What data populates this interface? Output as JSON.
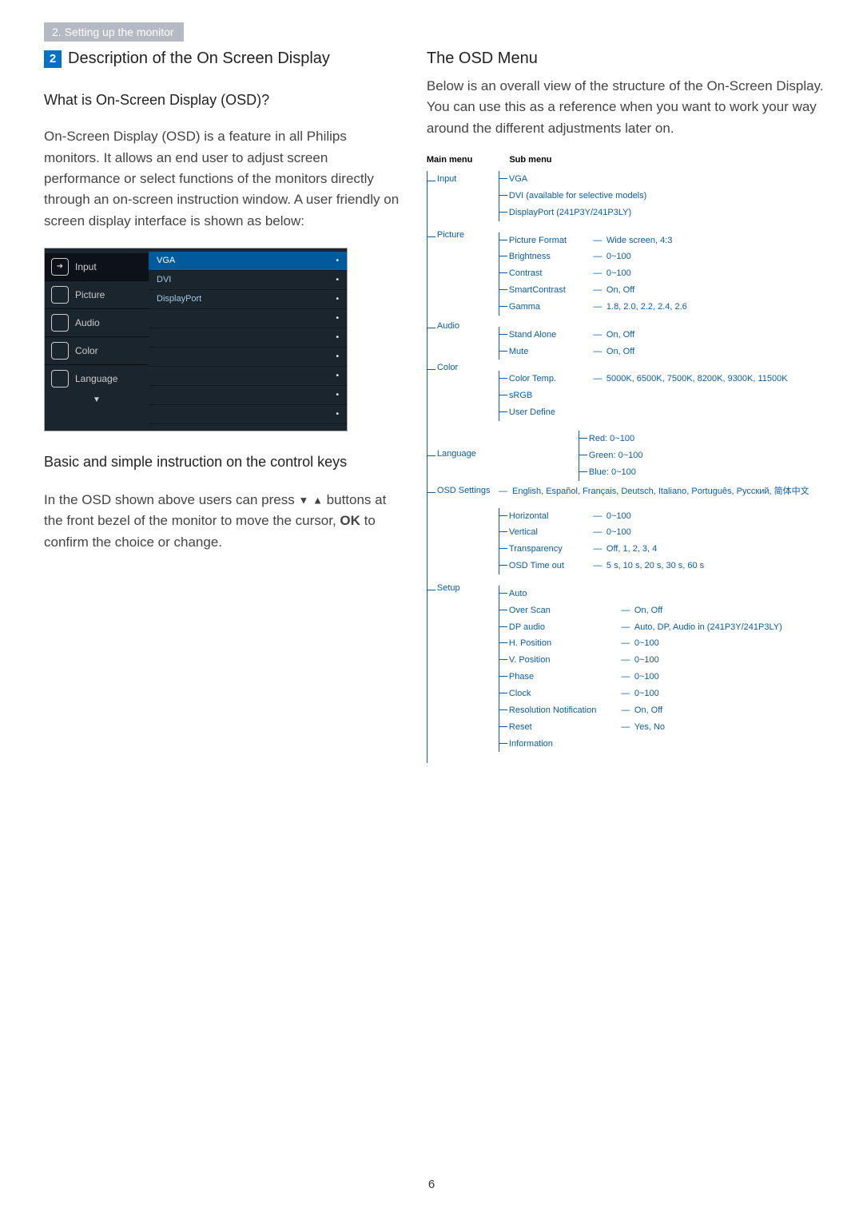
{
  "chapter_tab": "2. Setting up the monitor",
  "page_number": "6",
  "left": {
    "section_num": "2",
    "section_title": "Description of the On Screen Display",
    "q_title": "What is On-Screen Display (OSD)?",
    "body1": "On-Screen Display (OSD) is a feature in all Philips monitors. It allows an end user to adjust screen performance or select functions of the monitors directly through an on-screen instruction window. A user friendly on screen display interface is shown as below:",
    "osd_items": [
      "Input",
      "Picture",
      "Audio",
      "Color",
      "Language"
    ],
    "osd_right": [
      "VGA",
      "DVI",
      "DisplayPort"
    ],
    "keys_title": "Basic and simple instruction on the control keys",
    "body2a": "In the OSD shown above users can press ",
    "body2b": " buttons at the front bezel of the monitor to move the cursor, ",
    "body2c": " to confirm the choice or change.",
    "ok": "OK"
  },
  "right": {
    "title": "The OSD Menu",
    "body": "Below is an overall view of the structure of the On-Screen Display. You can use this as a reference when you want to work your way around the different adjustments later on.",
    "head_main": "Main menu",
    "head_sub": "Sub menu",
    "tree": {
      "input": {
        "label": "Input",
        "rows": [
          {
            "label": "VGA"
          },
          {
            "label": "DVI (available for selective models)"
          },
          {
            "label": "DisplayPort (241P3Y/241P3LY)"
          }
        ]
      },
      "picture": {
        "label": "Picture",
        "rows": [
          {
            "label": "Picture Format",
            "val": "Wide screen, 4:3"
          },
          {
            "label": "Brightness",
            "val": "0~100"
          },
          {
            "label": "Contrast",
            "val": "0~100"
          },
          {
            "label": "SmartContrast",
            "val": "On, Off"
          },
          {
            "label": "Gamma",
            "val": "1.8, 2.0, 2.2, 2.4, 2.6"
          }
        ]
      },
      "audio": {
        "label": "Audio",
        "rows": [
          {
            "label": "Stand Alone",
            "val": "On, Off"
          },
          {
            "label": "Mute",
            "val": "On, Off"
          }
        ]
      },
      "color": {
        "label": "Color",
        "rows": [
          {
            "label": "Color Temp.",
            "val": "5000K, 6500K, 7500K, 8200K, 9300K, 11500K"
          },
          {
            "label": "sRGB"
          },
          {
            "label": "User Define"
          }
        ],
        "userdef": [
          {
            "label": "Red: 0~100"
          },
          {
            "label": "Green: 0~100"
          },
          {
            "label": "Blue: 0~100"
          }
        ]
      },
      "language": {
        "label": "Language",
        "val": "English, Español, Français, Deutsch, Italiano, Português, Русский, 简体中文"
      },
      "osdsettings": {
        "label": "OSD Settings",
        "rows": [
          {
            "label": "Horizontal",
            "val": "0~100"
          },
          {
            "label": "Vertical",
            "val": "0~100"
          },
          {
            "label": "Transparency",
            "val": "Off, 1, 2, 3, 4"
          },
          {
            "label": "OSD Time out",
            "val": "5 s, 10 s, 20 s, 30 s, 60 s"
          }
        ]
      },
      "setup": {
        "label": "Setup",
        "rows": [
          {
            "label": "Auto"
          },
          {
            "label": "Over Scan",
            "val": "On, Off"
          },
          {
            "label": "DP audio",
            "val": "Auto, DP, Audio in (241P3Y/241P3LY)"
          },
          {
            "label": "H. Position",
            "val": "0~100"
          },
          {
            "label": "V. Position",
            "val": "0~100"
          },
          {
            "label": "Phase",
            "val": "0~100"
          },
          {
            "label": "Clock",
            "val": "0~100"
          },
          {
            "label": "Resolution Notification",
            "val": "On, Off",
            "wide": true
          },
          {
            "label": "Reset",
            "val": "Yes, No"
          },
          {
            "label": "Information"
          }
        ]
      }
    }
  }
}
